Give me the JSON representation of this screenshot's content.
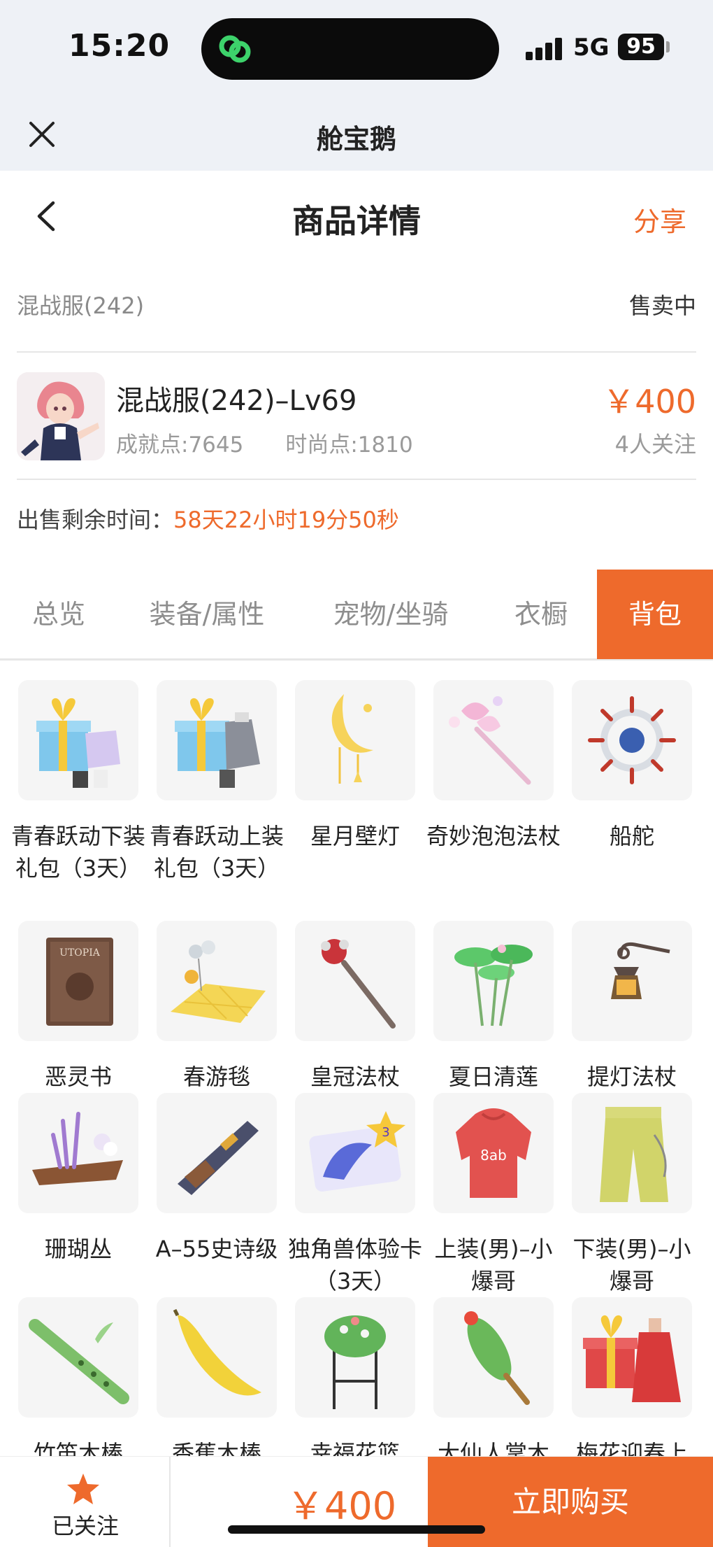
{
  "status_bar": {
    "time": "15:20",
    "network": "5G",
    "battery": "95"
  },
  "mini_header": {
    "title": "舱宝鹅"
  },
  "nav": {
    "title": "商品详情",
    "share": "分享"
  },
  "server": {
    "name": "混战服(242)",
    "status": "售卖中"
  },
  "item": {
    "title": "混战服(242)–Lv69",
    "achievement": "成就点:7645",
    "fashion": "时尚点:1810",
    "price": "￥400",
    "watchers": "4人关注"
  },
  "remaining": {
    "label": "出售剩余时间：",
    "time": "58天22小时19分50秒"
  },
  "tabs": [
    "总览",
    "装备/属性",
    "宠物/坐骑",
    "衣橱",
    "背包"
  ],
  "active_tab": "背包",
  "inventory": [
    {
      "name": "青春跃动下装礼包（3天）",
      "icon": "gift-box-icon"
    },
    {
      "name": "青春跃动上装礼包（3天）",
      "icon": "gift-box-icon"
    },
    {
      "name": "星月壁灯",
      "icon": "moon-lamp-icon"
    },
    {
      "name": "奇妙泡泡法杖",
      "icon": "bubble-wand-icon"
    },
    {
      "name": "船舵",
      "icon": "ship-wheel-icon"
    },
    {
      "name": "恶灵书",
      "icon": "book-icon"
    },
    {
      "name": "春游毯",
      "icon": "picnic-blanket-icon"
    },
    {
      "name": "皇冠法杖",
      "icon": "crown-staff-icon"
    },
    {
      "name": "夏日清莲",
      "icon": "lotus-icon"
    },
    {
      "name": "提灯法杖",
      "icon": "lantern-staff-icon"
    },
    {
      "name": "珊瑚丛",
      "icon": "coral-icon"
    },
    {
      "name": "A–55史诗级",
      "icon": "rifle-icon"
    },
    {
      "name": "独角兽体验卡（3天）",
      "icon": "unicorn-card-icon"
    },
    {
      "name": "上装(男)–小爆哥",
      "icon": "hoodie-icon"
    },
    {
      "name": "下装(男)–小爆哥",
      "icon": "pants-icon"
    },
    {
      "name": "竹笛木棒",
      "icon": "bamboo-flute-icon"
    },
    {
      "name": "香蕉木棒",
      "icon": "banana-icon"
    },
    {
      "name": "幸福花篮",
      "icon": "flower-basket-icon"
    },
    {
      "name": "大仙人掌木",
      "icon": "cactus-icon"
    },
    {
      "name": "梅花迎春上",
      "icon": "gift-outfit-icon"
    }
  ],
  "bottom": {
    "follow": "已关注",
    "total": "￥400",
    "buy": "立即购买"
  },
  "colors": {
    "accent": "#ee6a2c",
    "header_bg": "#eef1f6"
  }
}
